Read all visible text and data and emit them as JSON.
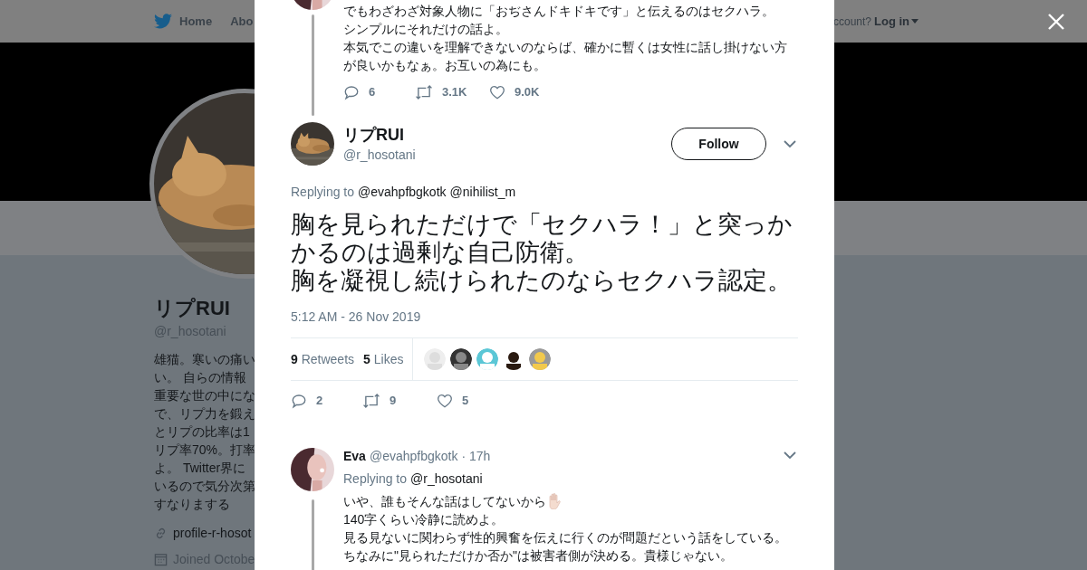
{
  "background_page": {
    "nav": {
      "items": [
        {
          "label": "Home",
          "kind": "home"
        },
        {
          "label": "Abo",
          "kind": "plain"
        }
      ],
      "account_prompt": "ccount?",
      "login": "Log in"
    },
    "profile": {
      "name": "リプRUI",
      "handle": "@r_hosotani",
      "bio_lines": [
        "雄猫。寒いの痛い",
        "い。 自らの情報",
        "重要な世の中にな",
        "で、リプ力を鍛え",
        "とリプの比率は1",
        "リプ率70%。打率",
        "よ。 Twitter界に",
        "いるので気分次第",
        "すなりまする"
      ],
      "website": "profile-r-hosot",
      "joined": "Joined Octobe"
    }
  },
  "modal": {
    "previous_tweet": {
      "text_lines": [
        "でもわざわざ対象人物に「おぢさんドキドキです」と伝えるのはセクハラ。",
        "シンプルにそれだけの話よ。",
        "本気でこの違いを理解できないのならば、確かに暫くは女性に話し掛けない方",
        "が良いかもなぁ。お互いの為にも。"
      ],
      "actions": [
        "6",
        "3.1K",
        "9.0K"
      ]
    },
    "main_tweet": {
      "name": "リプRUI",
      "handle": "@r_hosotani",
      "follow": "Follow",
      "replying_label": "Replying to",
      "replying_to": [
        "@evahpfbgkotk",
        "@nihilist_m"
      ],
      "text_lines": [
        "胸を見られただけで「セクハラ！」と突っか",
        "かるのは過剰な自己防衛。",
        "胸を凝視し続けられたのならセクハラ認定。"
      ],
      "timestamp": "5:12 AM - 26 Nov 2019",
      "stats": [
        {
          "count": "9",
          "label": "Retweets"
        },
        {
          "count": "5",
          "label": "Likes"
        }
      ],
      "actions": [
        "2",
        "9",
        "5"
      ]
    },
    "reply": {
      "name": "Eva",
      "handle": "@evahpfbgkotk",
      "time": "· 17h",
      "replying_label": "Replying to",
      "replying_to": [
        "@r_hosotani"
      ],
      "text_lines": [
        "いや、誰もそんな話はしてないから",
        "140字くらい冷静に読めよ。",
        "見る見ないに関わらず性的興奮を伝えに行くのが問題だという話をしている。",
        "ちなみに\"見られただけか否か\"は被害者側が決める。貴様じゃない。"
      ]
    }
  }
}
